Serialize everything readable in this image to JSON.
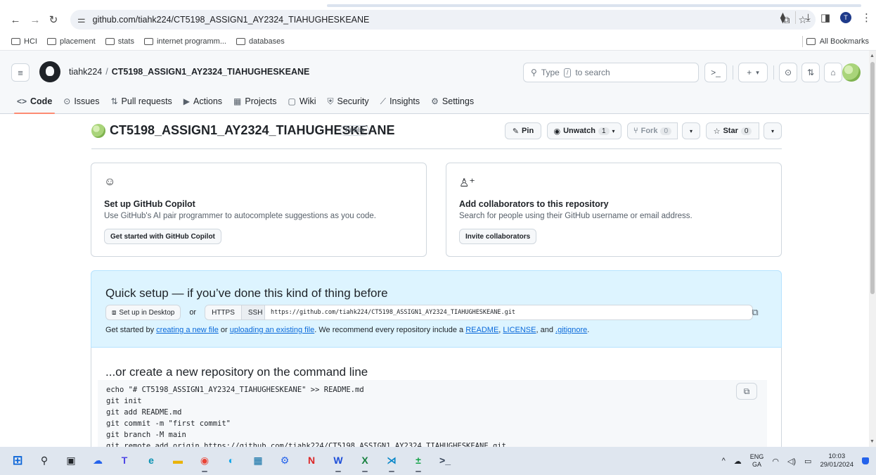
{
  "browser": {
    "url": "github.com/tiahk224/CT5198_ASSIGN1_AY2324_TIAHUGHESKEANE",
    "profile_initial": "T",
    "bookmarks": [
      "HCI",
      "placement",
      "stats",
      "internet programm...",
      "databases"
    ],
    "all_bookmarks": "All Bookmarks"
  },
  "header": {
    "owner": "tiahk224",
    "separator": "/",
    "repo": "CT5198_ASSIGN1_AY2324_TIAHUGHESKEANE",
    "search_prefix": "Type",
    "search_key": "/",
    "search_suffix": "to search",
    "plus": "+",
    "caret": "▾"
  },
  "tabs": [
    {
      "label": "Code",
      "icon": "<>"
    },
    {
      "label": "Issues",
      "icon": "⊙"
    },
    {
      "label": "Pull requests",
      "icon": "⇅"
    },
    {
      "label": "Actions",
      "icon": "▶"
    },
    {
      "label": "Projects",
      "icon": "▦"
    },
    {
      "label": "Wiki",
      "icon": "▢"
    },
    {
      "label": "Security",
      "icon": "⛨"
    },
    {
      "label": "Insights",
      "icon": "⟋"
    },
    {
      "label": "Settings",
      "icon": "⚙"
    }
  ],
  "repo": {
    "name": "CT5198_ASSIGN1_AY2324_TIAHUGHESKEANE",
    "visibility": "Public",
    "pin": "Pin",
    "unwatch": "Unwatch",
    "watch_count": "1",
    "fork": "Fork",
    "fork_count": "0",
    "star": "Star",
    "star_count": "0"
  },
  "cards": {
    "copilot": {
      "title": "Set up GitHub Copilot",
      "desc": "Use GitHub's AI pair programmer to autocomplete suggestions as you code.",
      "button": "Get started with GitHub Copilot"
    },
    "collab": {
      "title": "Add collaborators to this repository",
      "desc": "Search for people using their GitHub username or email address.",
      "button": "Invite collaborators"
    }
  },
  "quick": {
    "title": "Quick setup — if you’ve done this kind of thing before",
    "desktop": "Set up in Desktop",
    "or": "or",
    "https": "HTTPS",
    "ssh": "SSH",
    "url": "https://github.com/tiahk224/CT5198_ASSIGN1_AY2324_TIAHUGHESKEANE.git",
    "note_prefix": "Get started by ",
    "link_new_file": "creating a new file",
    "note_or": " or ",
    "link_upload": "uploading an existing file",
    "note_mid": ". We recommend every repository include a ",
    "link_readme": "README",
    "comma": ", ",
    "link_license": "LICENSE",
    "note_and": ", and ",
    "link_gitignore": ".gitignore",
    "period": "."
  },
  "cmdline": {
    "title": "...or create a new repository on the command line",
    "lines": [
      "echo \"# CT5198_ASSIGN1_AY2324_TIAHUGHESKEANE\" >> README.md",
      "git init",
      "git add README.md",
      "git commit -m \"first commit\"",
      "git branch -M main",
      "git remote add origin https://github.com/tiahk224/CT5198_ASSIGN1_AY2324_TIAHUGHESKEANE.git"
    ]
  },
  "taskbar": {
    "lang_top": "ENG",
    "lang_bottom": "GA",
    "time": "10:03",
    "date": "29/01/2024",
    "chevron": "^"
  }
}
